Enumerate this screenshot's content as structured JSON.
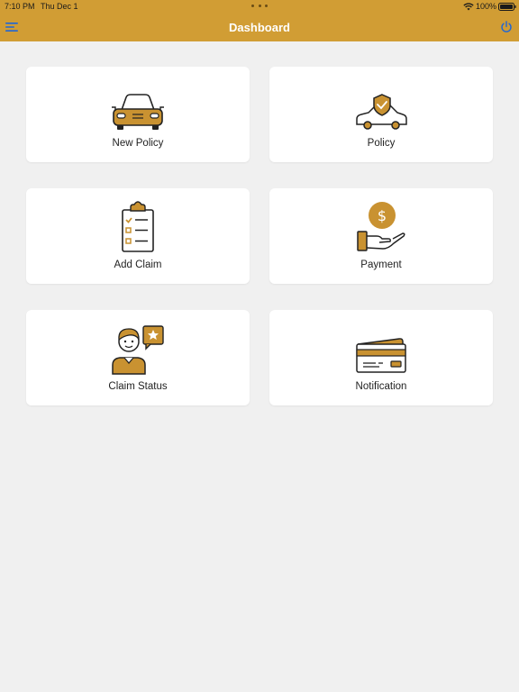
{
  "status_bar": {
    "time": "7:10 PM",
    "date": "Thu Dec 1",
    "battery": "100%"
  },
  "header": {
    "title": "Dashboard"
  },
  "icons": {
    "menu": "menu-lines-icon",
    "power": "power-icon",
    "wifi": "wifi-icon",
    "battery": "battery-icon"
  },
  "colors": {
    "accent": "#d19d34",
    "background": "#f0f0f0",
    "card": "#ffffff"
  },
  "tiles": [
    {
      "label": "New Policy",
      "icon": "car-icon"
    },
    {
      "label": "Policy",
      "icon": "car-shield-icon"
    },
    {
      "label": "Add Claim",
      "icon": "clipboard-checklist-icon"
    },
    {
      "label": "Payment",
      "icon": "hand-coin-icon"
    },
    {
      "label": "Claim Status",
      "icon": "person-chat-star-icon"
    },
    {
      "label": "Notification",
      "icon": "credit-card-icon"
    }
  ]
}
